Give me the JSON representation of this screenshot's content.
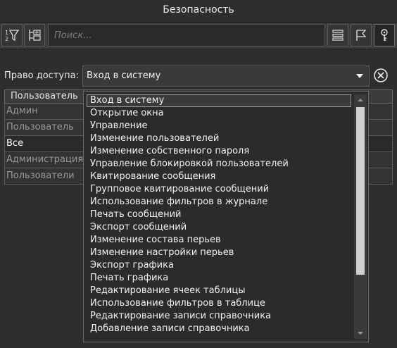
{
  "window": {
    "title": "Безопасность"
  },
  "toolbar": {
    "search_placeholder": "Поиск...",
    "buttons": [
      {
        "icon": "filter-sort-icon"
      },
      {
        "icon": "tree-expand-icon"
      },
      {
        "icon": "list-view-icon"
      },
      {
        "icon": "flag-icon"
      },
      {
        "icon": "key-icon"
      }
    ]
  },
  "access": {
    "label": "Право доступа:",
    "selected": "Вход в систему"
  },
  "table": {
    "header": "Пользователь",
    "rows": [
      {
        "label": "Админ",
        "style": "dim"
      },
      {
        "label": "Пользователь",
        "style": "dim"
      },
      {
        "label": "Все",
        "style": "bright"
      },
      {
        "label": "Администрация",
        "style": "dim"
      },
      {
        "label": "Пользователи",
        "style": "dim"
      }
    ]
  },
  "dropdown": {
    "items": [
      "Вход в систему",
      "Открытие окна",
      "Управление",
      "Изменение пользователей",
      "Изменение собственного пароля",
      "Управление блокировкой пользователей",
      "Квитирование сообщения",
      "Групповое квитирование сообщений",
      "Использование фильтров в журнале",
      "Печать сообщений",
      "Экспорт сообщений",
      "Изменение состава перьев",
      "Изменение настройки перьев",
      "Экспорт графика",
      "Печать графика",
      "Редактирование ячеек таблицы",
      "Использование фильтров в таблице",
      "Редактирование записи справочника",
      "Добавление записи справочника"
    ]
  },
  "colors": {
    "background": "#2e2e2e",
    "text": "#ffffff",
    "dim_text": "#9a9a9a"
  }
}
